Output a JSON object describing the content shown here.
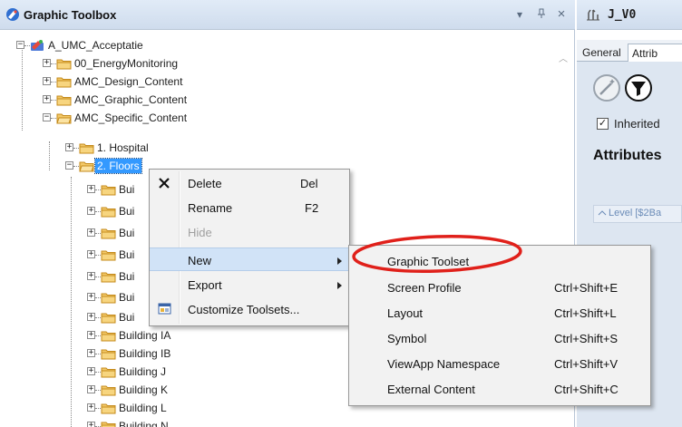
{
  "left_panel": {
    "title": "Graphic Toolbox",
    "controls": {
      "dropdown": "▾",
      "pin": "▐",
      "close": "×"
    },
    "tree": [
      {
        "label": "A_UMC_Acceptatie",
        "expander": "−",
        "icon": "project-icon"
      },
      {
        "label": "00_EnergyMonitoring",
        "expander": "+",
        "icon": "folder-icon"
      },
      {
        "label": "AMC_Design_Content",
        "expander": "+",
        "icon": "folder-icon"
      },
      {
        "label": "AMC_Graphic_Content",
        "expander": "+",
        "icon": "folder-icon"
      },
      {
        "label": "AMC_Specific_Content",
        "expander": "−",
        "icon": "folder-icon"
      },
      {
        "label": "1. Hospital",
        "expander": "+",
        "icon": "folder-icon"
      },
      {
        "label": "2. Floors",
        "expander": "−",
        "icon": "folder-icon",
        "selected": true
      },
      {
        "label": "Bui",
        "expander": "+",
        "icon": "folder-icon"
      },
      {
        "label": "Bui",
        "expander": "+",
        "icon": "folder-icon"
      },
      {
        "label": "Bui",
        "expander": "+",
        "icon": "folder-icon"
      },
      {
        "label": "Bui",
        "expander": "+",
        "icon": "folder-icon"
      },
      {
        "label": "Bui",
        "expander": "+",
        "icon": "folder-icon"
      },
      {
        "label": "Bui",
        "expander": "+",
        "icon": "folder-icon"
      },
      {
        "label": "Bui",
        "expander": "+",
        "icon": "folder-icon"
      },
      {
        "label": "Building IA",
        "expander": "+",
        "icon": "folder-icon"
      },
      {
        "label": "Building IB",
        "expander": "+",
        "icon": "folder-icon"
      },
      {
        "label": "Building J",
        "expander": "+",
        "icon": "folder-icon"
      },
      {
        "label": "Building K",
        "expander": "+",
        "icon": "folder-icon"
      },
      {
        "label": "Building L",
        "expander": "+",
        "icon": "folder-icon"
      },
      {
        "label": "Building N",
        "expander": "+",
        "icon": "folder-icon"
      }
    ]
  },
  "right_panel": {
    "title": "J_V0",
    "tabs": [
      "General",
      "Attrib"
    ],
    "inherited_label": "Inherited",
    "inherited_checked": "✓",
    "attributes_heading": "Attributes",
    "attribute_row": "Level [$2Ba"
  },
  "context_menu": {
    "items": [
      {
        "label": "Delete",
        "shortcut": "Del",
        "icon": "delete-x-icon"
      },
      {
        "label": "Rename",
        "shortcut": "F2"
      },
      {
        "label": "Hide",
        "shortcut": "",
        "disabled": true
      },
      {
        "label": "New",
        "submenu": true,
        "highlighted": true
      },
      {
        "label": "Export",
        "submenu": true
      },
      {
        "label": "Customize Toolsets...",
        "icon": "customize-toolsets-icon"
      }
    ]
  },
  "submenu": {
    "items": [
      {
        "label": "Graphic Toolset",
        "shortcut": ""
      },
      {
        "label": "Screen Profile",
        "shortcut": "Ctrl+Shift+E"
      },
      {
        "label": "Layout",
        "shortcut": "Ctrl+Shift+L"
      },
      {
        "label": "Symbol",
        "shortcut": "Ctrl+Shift+S"
      },
      {
        "label": "ViewApp Namespace",
        "shortcut": "Ctrl+Shift+V"
      },
      {
        "label": "External Content",
        "shortcut": "Ctrl+Shift+C"
      }
    ]
  },
  "colors": {
    "selection": "#3399ff",
    "menu_highlight": "#d1e3f7",
    "annotation_ellipse": "#e0201a",
    "folder": "#f3c969"
  }
}
